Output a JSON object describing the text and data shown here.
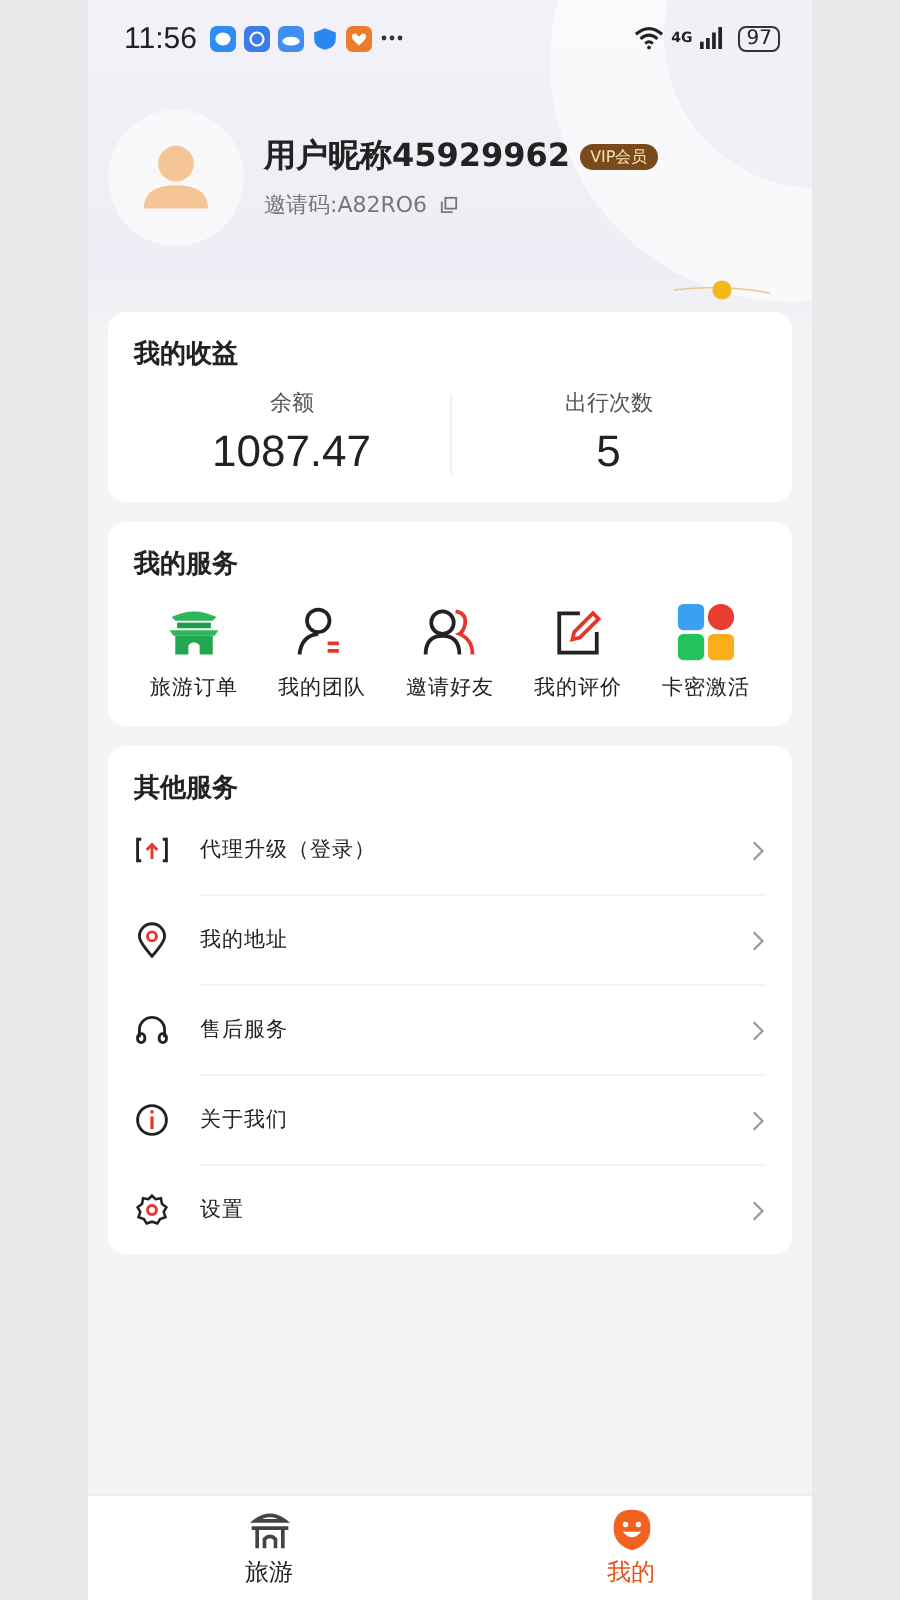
{
  "status_bar": {
    "time": "11:56",
    "network": "4G",
    "battery": "97"
  },
  "profile": {
    "nickname": "用户昵称45929962",
    "badge": "VIP会员",
    "invite_code": "邀请码:A82RO6"
  },
  "earnings": {
    "title": "我的收益",
    "stats": [
      {
        "label": "余额",
        "value": "1087.47"
      },
      {
        "label": "出行次数",
        "value": "5"
      }
    ]
  },
  "my_services": {
    "title": "我的服务",
    "items": [
      {
        "kind": "order",
        "label": "旅游订单"
      },
      {
        "kind": "team",
        "label": "我的团队"
      },
      {
        "kind": "invite",
        "label": "邀请好友"
      },
      {
        "kind": "review",
        "label": "我的评价"
      },
      {
        "kind": "card",
        "label": "卡密激活"
      }
    ]
  },
  "other_services": {
    "title": "其他服务",
    "items": [
      {
        "kind": "upgrade",
        "label": "代理升级（登录）"
      },
      {
        "kind": "address",
        "label": "我的地址"
      },
      {
        "kind": "support",
        "label": "售后服务"
      },
      {
        "kind": "about",
        "label": "关于我们"
      },
      {
        "kind": "settings",
        "label": "设置"
      }
    ]
  },
  "tab_bar": [
    {
      "kind": "travel",
      "label": "旅游",
      "selected": false
    },
    {
      "kind": "me",
      "label": "我的",
      "selected": true
    }
  ]
}
